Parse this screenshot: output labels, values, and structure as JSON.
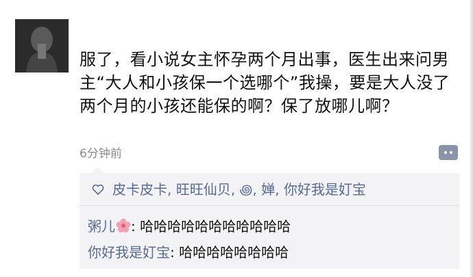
{
  "post": {
    "text": "服了，看小说女主怀孕两个月出事，医生出来问男主“大人和小孩保一个选哪个”我操，要是大人没了两个月的小孩还能保的啊？保了放哪儿啊？",
    "time": "6分钟前"
  },
  "likes": {
    "names": "皮卡皮卡, 旺旺仙贝, ꩜, 婵, 你好我是奵宝"
  },
  "comments": [
    {
      "author": "粥儿",
      "sep": ": ",
      "text": "哈哈哈哈哈哈哈哈哈哈哈"
    },
    {
      "author": "你好我是奵宝",
      "sep": ": ",
      "text": "哈哈哈哈哈哈哈哈"
    }
  ],
  "colors": {
    "link": "#576b95",
    "panel": "#f3f3f5",
    "time": "#8c8c8c"
  },
  "icons": [
    "avatar",
    "comment-dots-icon",
    "heart-icon",
    "flower-emoji-icon"
  ]
}
